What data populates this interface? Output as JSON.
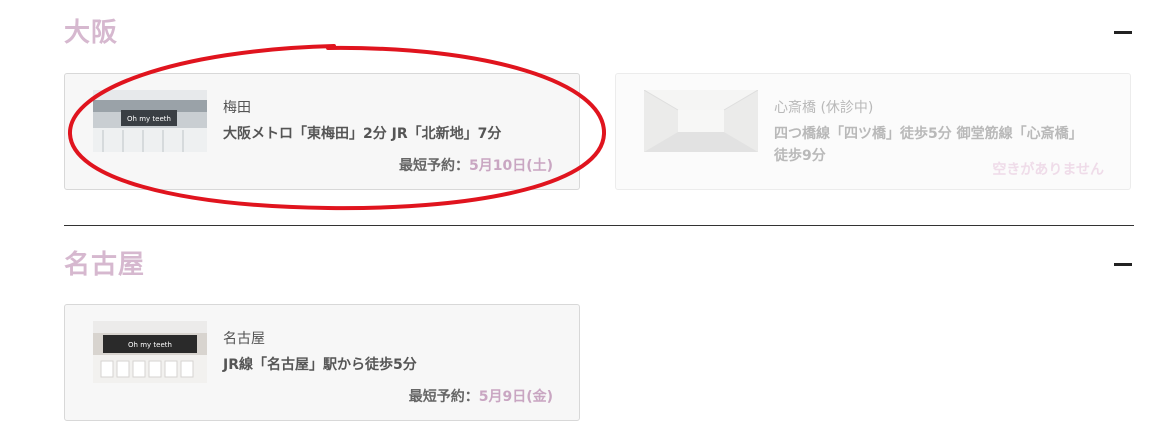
{
  "regions": [
    {
      "title": "大阪",
      "clinics": [
        {
          "name": "梅田",
          "access": "大阪メトロ「東梅田」2分 JR「北新地」7分",
          "reserve_label": "最短予約：",
          "reserve_date": "5月10日(土)"
        },
        {
          "name": "心斎橋 (休診中)",
          "access": "四つ橋線「四ツ橋」徒歩5分 御堂筋線「心斎橋」徒歩9分",
          "status": "空きがありません"
        }
      ]
    },
    {
      "title": "名古屋",
      "clinics": [
        {
          "name": "名古屋",
          "access": "JR線「名古屋」駅から徒歩5分",
          "reserve_label": "最短予約：",
          "reserve_date": "5月9日(金)"
        }
      ]
    }
  ],
  "thumb_logo": "Oh my teeth",
  "colors": {
    "region_title": "#d6b8cf",
    "reserve_date": "#c9a6c2",
    "annotation": "#e0141e",
    "unavailable": "#efdce9"
  }
}
